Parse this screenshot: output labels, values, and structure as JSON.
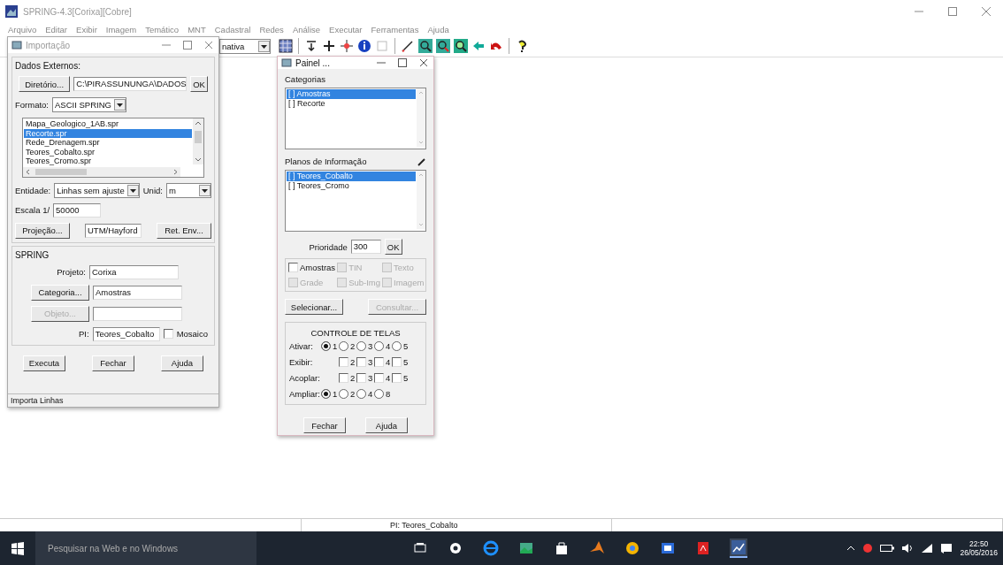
{
  "window": {
    "title": "SPRING-4.3[Corixa][Cobre]"
  },
  "menu": [
    "Arquivo",
    "Editar",
    "Exibir",
    "Imagem",
    "Temático",
    "MNT",
    "Cadastral",
    "Redes",
    "Análise",
    "Executar",
    "Ferramentas",
    "Ajuda"
  ],
  "toolbar": {
    "mode": "nativa"
  },
  "import_dialog": {
    "title": "Importação",
    "external_data": {
      "title": "Dados Externos:",
      "directory_button": "Diretório...",
      "directory": "C:\\PIRASSUNUNGA\\DADOS",
      "ok_button": "OK",
      "format_label": "Formato:",
      "format": "ASCII SPRING",
      "files": [
        {
          "label": "Mapa_Geologico_1AB.spr",
          "selected": false
        },
        {
          "label": "Recorte.spr",
          "selected": true
        },
        {
          "label": "Rede_Drenagem.spr",
          "selected": false
        },
        {
          "label": "Teores_Cobalto.spr",
          "selected": false
        },
        {
          "label": "Teores_Cromo.spr",
          "selected": false
        }
      ],
      "entity_label": "Entidade:",
      "entity": "Linhas sem ajuste",
      "unit_label": "Unid:",
      "unit": "m",
      "scale_label": "Escala 1/",
      "scale": "50000",
      "projection_button": "Projeção...",
      "projection": "UTM/Hayford",
      "envelope_button": "Ret. Env..."
    },
    "spring": {
      "title": "SPRING",
      "project_label": "Projeto:",
      "project": "Corixa",
      "category_button": "Categoria...",
      "category": "Amostras",
      "object_button": {
        "label": "Objeto...",
        "disabled": true
      },
      "pi_label": "PI:",
      "pi": "Teores_Cobalto",
      "mosaic": {
        "label": "Mosaico",
        "checked": false
      }
    },
    "buttons": [
      "Executa",
      "Fechar",
      "Ajuda"
    ],
    "status": "Importa Linhas"
  },
  "panel_dialog": {
    "title": "Painel ...",
    "categories_label": "Categorias",
    "categories": [
      {
        "label": "[ ] Amostras",
        "selected": true
      },
      {
        "label": "[ ] Recorte",
        "selected": false
      }
    ],
    "planes_label": "Planos de Informação",
    "planes": [
      {
        "label": "[ ] Teores_Cobalto",
        "selected": true
      },
      {
        "label": "[ ] Teores_Cromo",
        "selected": false
      }
    ],
    "priority_label": "Prioridade",
    "priority": "300",
    "ok_button": "OK",
    "representations": [
      {
        "label": "Amostras",
        "checked": false,
        "disabled": false
      },
      {
        "label": "TIN",
        "checked": false,
        "disabled": true
      },
      {
        "label": "Texto",
        "checked": false,
        "disabled": true
      },
      {
        "label": "Grade",
        "checked": false,
        "disabled": true
      },
      {
        "label": "Sub-Img",
        "checked": false,
        "disabled": true
      },
      {
        "label": "Imagem",
        "checked": false,
        "disabled": true
      }
    ],
    "select_button": {
      "label": "Selecionar...",
      "disabled": false
    },
    "query_button": {
      "label": "Consultar...",
      "disabled": true
    },
    "screen_control": {
      "title": "CONTROLE DE TELAS",
      "rows": [
        {
          "label": "Ativar:",
          "kind": "radio",
          "options": [
            {
              "label": "1",
              "selected": true
            },
            {
              "label": "2",
              "selected": false
            },
            {
              "label": "3",
              "selected": false
            },
            {
              "label": "4",
              "selected": false
            },
            {
              "label": "5",
              "selected": false
            }
          ]
        },
        {
          "label": "Exibir:",
          "kind": "checkbox",
          "options": [
            {
              "label": "2",
              "checked": false
            },
            {
              "label": "3",
              "checked": false
            },
            {
              "label": "4",
              "checked": false
            },
            {
              "label": "5",
              "checked": false
            }
          ]
        },
        {
          "label": "Acoplar:",
          "kind": "checkbox",
          "options": [
            {
              "label": "2",
              "checked": false
            },
            {
              "label": "3",
              "checked": false
            },
            {
              "label": "4",
              "checked": false
            },
            {
              "label": "5",
              "checked": false
            }
          ]
        },
        {
          "label": "Ampliar:",
          "kind": "radio",
          "options": [
            {
              "label": "1",
              "selected": true
            },
            {
              "label": "2",
              "selected": false
            },
            {
              "label": "4",
              "selected": false
            },
            {
              "label": "8",
              "selected": false
            }
          ]
        }
      ]
    },
    "buttons": [
      "Fechar",
      "Ajuda"
    ]
  },
  "status_bar": {
    "text": "PI: Teores_Cobalto"
  },
  "taskbar": {
    "search_placeholder": "Pesquisar na Web e no Windows",
    "time": "22:50",
    "date": "26/05/2016"
  }
}
